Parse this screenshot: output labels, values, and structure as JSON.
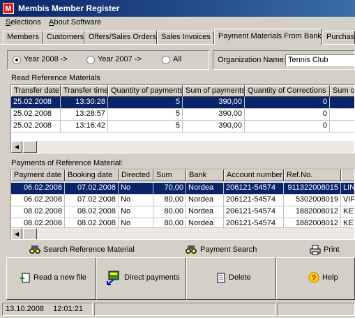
{
  "window": {
    "title": "Membis Member Register",
    "icon_letter": "M"
  },
  "menu": [
    {
      "label": "Selections"
    },
    {
      "label": "About Software"
    }
  ],
  "tabs": [
    {
      "label": "Members"
    },
    {
      "label": "Customers"
    },
    {
      "label": "Offers/Sales Orders"
    },
    {
      "label": "Sales Invoices"
    },
    {
      "label": "Payment Materials From Bank",
      "active": true
    },
    {
      "label": "Purchase"
    }
  ],
  "filter": {
    "options": [
      {
        "label": "Year 2008 ->",
        "selected": true
      },
      {
        "label": "Year 2007 ->"
      },
      {
        "label": "All"
      }
    ],
    "org_label": "Organization Name:",
    "org_value": "Tennis Club"
  },
  "reference": {
    "section_label": "Read Reference Materials",
    "columns": [
      "Transfer date",
      "Transfer time",
      "Quantity of payments",
      "Sum of payments",
      "Quantity of Corrections",
      "Sum o"
    ],
    "rows": [
      [
        "25.02.2008",
        "13:30:28",
        "5",
        "390,00",
        "0",
        ""
      ],
      [
        "25.02.2008",
        "13:28:57",
        "5",
        "390,00",
        "0",
        ""
      ],
      [
        "25.02.2008",
        "13:16:42",
        "5",
        "390,00",
        "0",
        ""
      ]
    ]
  },
  "payments": {
    "section_label": "Payments of Reference Material:",
    "columns": [
      "Payment date",
      "Booking date",
      "Directed",
      "Sum",
      "Bank",
      "Account number",
      "Ref.No.",
      ""
    ],
    "rows": [
      [
        "06.02.2008",
        "07.02.2008",
        "No",
        "70,00",
        "Nordea",
        "206121-54574",
        "911322008015",
        "LIN"
      ],
      [
        "06.02.2008",
        "07.02.2008",
        "No",
        "80,00",
        "Nordea",
        "206121-54574",
        "5302008019",
        "VIR"
      ],
      [
        "08.02.2008",
        "08.02.2008",
        "No",
        "80,00",
        "Nordea",
        "206121-54574",
        "1882008012",
        "KET"
      ],
      [
        "08.02.2008",
        "08.02.2008",
        "No",
        "80,00",
        "Nordea",
        "206121-54574",
        "1882008012",
        "KET"
      ]
    ]
  },
  "actions": {
    "search_reference": "Search Reference Material",
    "payment_search": "Payment Search",
    "print": "Print",
    "read_file": "Read a new file",
    "direct_payments": "Direct payments",
    "delete": "Delete",
    "help": "Help"
  },
  "status": {
    "date": "13.10.2008",
    "time": "12:01:21"
  }
}
